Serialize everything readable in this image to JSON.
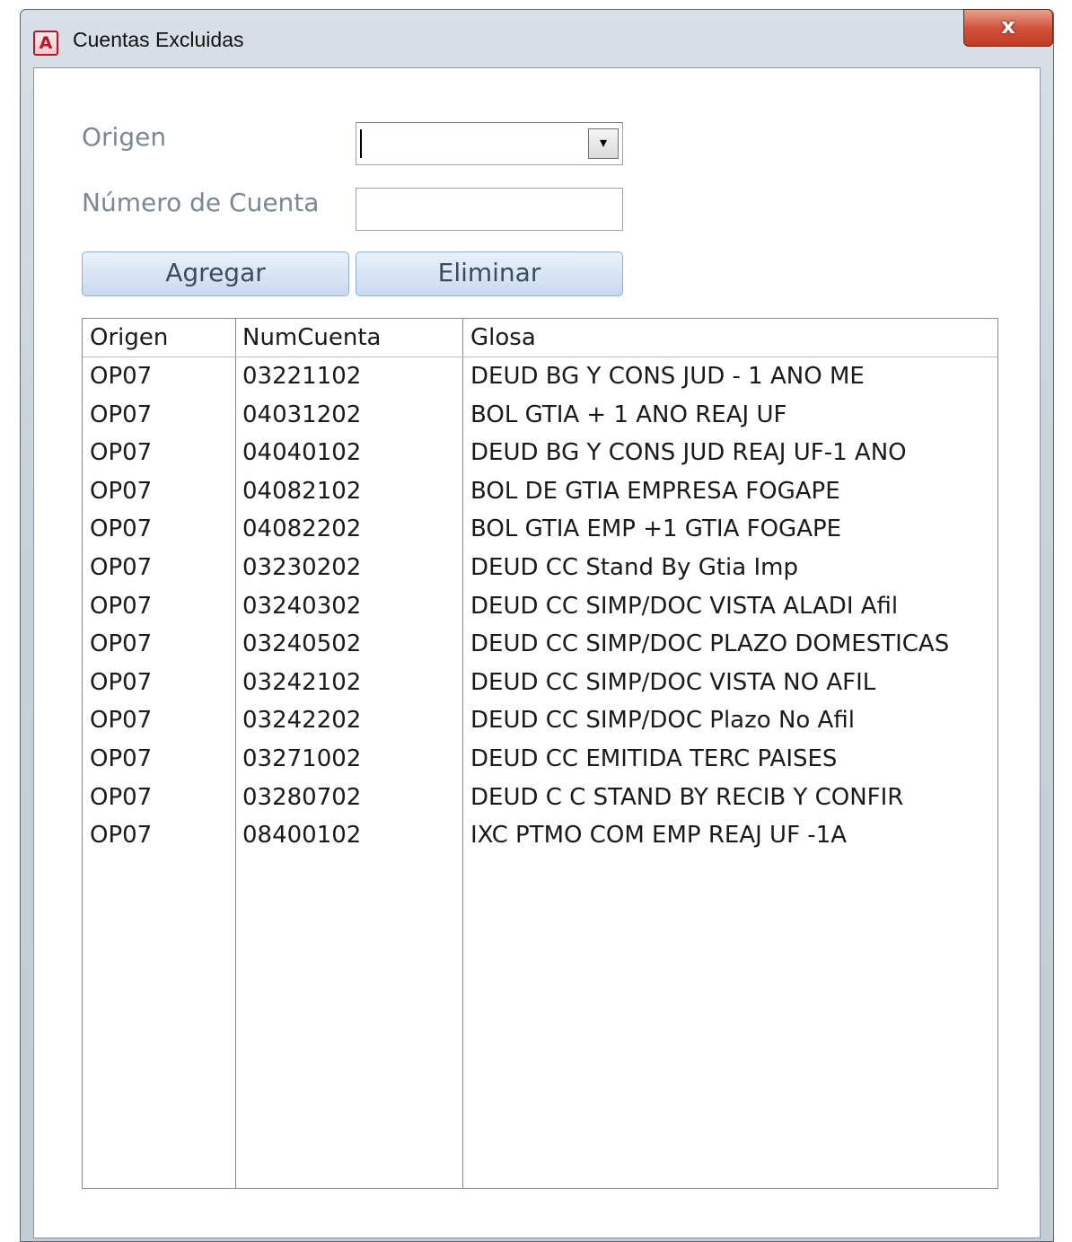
{
  "window": {
    "title": "Cuentas Excluidas",
    "app_icon_letter": "A",
    "close_glyph": "x"
  },
  "form": {
    "origen_label": "Origen",
    "origen_value": "",
    "numero_label": "Número de Cuenta",
    "numero_value": "",
    "dropdown_glyph": "▾",
    "agregar_label": "Agregar",
    "eliminar_label": "Eliminar"
  },
  "table": {
    "headers": [
      "Origen",
      "NumCuenta",
      "Glosa"
    ],
    "rows": [
      [
        "OP07",
        "03221102",
        "DEUD BG Y CONS JUD - 1 ANO ME"
      ],
      [
        "OP07",
        "04031202",
        "BOL GTIA + 1 ANO REAJ UF"
      ],
      [
        "OP07",
        "04040102",
        "DEUD BG Y CONS JUD REAJ UF-1 ANO"
      ],
      [
        "OP07",
        "04082102",
        "BOL DE GTIA EMPRESA  FOGAPE"
      ],
      [
        "OP07",
        "04082202",
        "BOL GTIA EMP +1 GTIA FOGAPE"
      ],
      [
        "OP07",
        "03230202",
        "DEUD CC Stand By Gtia Imp"
      ],
      [
        "OP07",
        "03240302",
        "DEUD CC SIMP/DOC VISTA ALADI Afil"
      ],
      [
        "OP07",
        "03240502",
        "DEUD CC SIMP/DOC PLAZO DOMESTICAS"
      ],
      [
        "OP07",
        "03242102",
        "DEUD CC SIMP/DOC VISTA NO AFIL"
      ],
      [
        "OP07",
        "03242202",
        "DEUD CC SIMP/DOC Plazo No Afil"
      ],
      [
        "OP07",
        "03271002",
        "DEUD CC EMITIDA TERC PAISES"
      ],
      [
        "OP07",
        "03280702",
        "DEUD C C STAND BY RECIB Y CONFIR"
      ],
      [
        "OP07",
        "08400102",
        "IXC PTMO COM EMP REAJ UF -1A"
      ]
    ]
  }
}
